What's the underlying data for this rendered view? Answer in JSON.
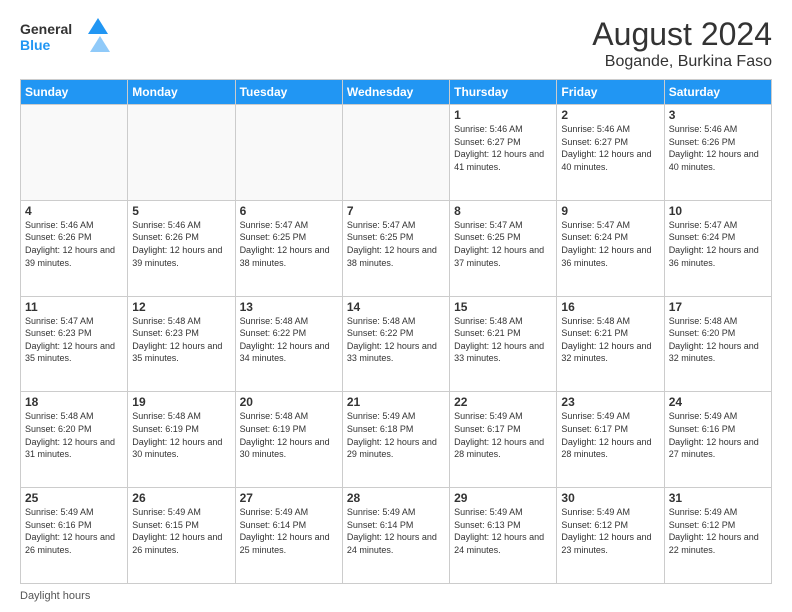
{
  "header": {
    "logo": "GeneralBlue",
    "title": "August 2024",
    "subtitle": "Bogande, Burkina Faso"
  },
  "days_of_week": [
    "Sunday",
    "Monday",
    "Tuesday",
    "Wednesday",
    "Thursday",
    "Friday",
    "Saturday"
  ],
  "footer": {
    "daylight_hours_label": "Daylight hours"
  },
  "weeks": [
    {
      "days": [
        {
          "num": "",
          "info": ""
        },
        {
          "num": "",
          "info": ""
        },
        {
          "num": "",
          "info": ""
        },
        {
          "num": "",
          "info": ""
        },
        {
          "num": "1",
          "info": "Sunrise: 5:46 AM\nSunset: 6:27 PM\nDaylight: 12 hours and 41 minutes."
        },
        {
          "num": "2",
          "info": "Sunrise: 5:46 AM\nSunset: 6:27 PM\nDaylight: 12 hours and 40 minutes."
        },
        {
          "num": "3",
          "info": "Sunrise: 5:46 AM\nSunset: 6:26 PM\nDaylight: 12 hours and 40 minutes."
        }
      ]
    },
    {
      "days": [
        {
          "num": "4",
          "info": "Sunrise: 5:46 AM\nSunset: 6:26 PM\nDaylight: 12 hours and 39 minutes."
        },
        {
          "num": "5",
          "info": "Sunrise: 5:46 AM\nSunset: 6:26 PM\nDaylight: 12 hours and 39 minutes."
        },
        {
          "num": "6",
          "info": "Sunrise: 5:47 AM\nSunset: 6:25 PM\nDaylight: 12 hours and 38 minutes."
        },
        {
          "num": "7",
          "info": "Sunrise: 5:47 AM\nSunset: 6:25 PM\nDaylight: 12 hours and 38 minutes."
        },
        {
          "num": "8",
          "info": "Sunrise: 5:47 AM\nSunset: 6:25 PM\nDaylight: 12 hours and 37 minutes."
        },
        {
          "num": "9",
          "info": "Sunrise: 5:47 AM\nSunset: 6:24 PM\nDaylight: 12 hours and 36 minutes."
        },
        {
          "num": "10",
          "info": "Sunrise: 5:47 AM\nSunset: 6:24 PM\nDaylight: 12 hours and 36 minutes."
        }
      ]
    },
    {
      "days": [
        {
          "num": "11",
          "info": "Sunrise: 5:47 AM\nSunset: 6:23 PM\nDaylight: 12 hours and 35 minutes."
        },
        {
          "num": "12",
          "info": "Sunrise: 5:48 AM\nSunset: 6:23 PM\nDaylight: 12 hours and 35 minutes."
        },
        {
          "num": "13",
          "info": "Sunrise: 5:48 AM\nSunset: 6:22 PM\nDaylight: 12 hours and 34 minutes."
        },
        {
          "num": "14",
          "info": "Sunrise: 5:48 AM\nSunset: 6:22 PM\nDaylight: 12 hours and 33 minutes."
        },
        {
          "num": "15",
          "info": "Sunrise: 5:48 AM\nSunset: 6:21 PM\nDaylight: 12 hours and 33 minutes."
        },
        {
          "num": "16",
          "info": "Sunrise: 5:48 AM\nSunset: 6:21 PM\nDaylight: 12 hours and 32 minutes."
        },
        {
          "num": "17",
          "info": "Sunrise: 5:48 AM\nSunset: 6:20 PM\nDaylight: 12 hours and 32 minutes."
        }
      ]
    },
    {
      "days": [
        {
          "num": "18",
          "info": "Sunrise: 5:48 AM\nSunset: 6:20 PM\nDaylight: 12 hours and 31 minutes."
        },
        {
          "num": "19",
          "info": "Sunrise: 5:48 AM\nSunset: 6:19 PM\nDaylight: 12 hours and 30 minutes."
        },
        {
          "num": "20",
          "info": "Sunrise: 5:48 AM\nSunset: 6:19 PM\nDaylight: 12 hours and 30 minutes."
        },
        {
          "num": "21",
          "info": "Sunrise: 5:49 AM\nSunset: 6:18 PM\nDaylight: 12 hours and 29 minutes."
        },
        {
          "num": "22",
          "info": "Sunrise: 5:49 AM\nSunset: 6:17 PM\nDaylight: 12 hours and 28 minutes."
        },
        {
          "num": "23",
          "info": "Sunrise: 5:49 AM\nSunset: 6:17 PM\nDaylight: 12 hours and 28 minutes."
        },
        {
          "num": "24",
          "info": "Sunrise: 5:49 AM\nSunset: 6:16 PM\nDaylight: 12 hours and 27 minutes."
        }
      ]
    },
    {
      "days": [
        {
          "num": "25",
          "info": "Sunrise: 5:49 AM\nSunset: 6:16 PM\nDaylight: 12 hours and 26 minutes."
        },
        {
          "num": "26",
          "info": "Sunrise: 5:49 AM\nSunset: 6:15 PM\nDaylight: 12 hours and 26 minutes."
        },
        {
          "num": "27",
          "info": "Sunrise: 5:49 AM\nSunset: 6:14 PM\nDaylight: 12 hours and 25 minutes."
        },
        {
          "num": "28",
          "info": "Sunrise: 5:49 AM\nSunset: 6:14 PM\nDaylight: 12 hours and 24 minutes."
        },
        {
          "num": "29",
          "info": "Sunrise: 5:49 AM\nSunset: 6:13 PM\nDaylight: 12 hours and 24 minutes."
        },
        {
          "num": "30",
          "info": "Sunrise: 5:49 AM\nSunset: 6:12 PM\nDaylight: 12 hours and 23 minutes."
        },
        {
          "num": "31",
          "info": "Sunrise: 5:49 AM\nSunset: 6:12 PM\nDaylight: 12 hours and 22 minutes."
        }
      ]
    }
  ]
}
